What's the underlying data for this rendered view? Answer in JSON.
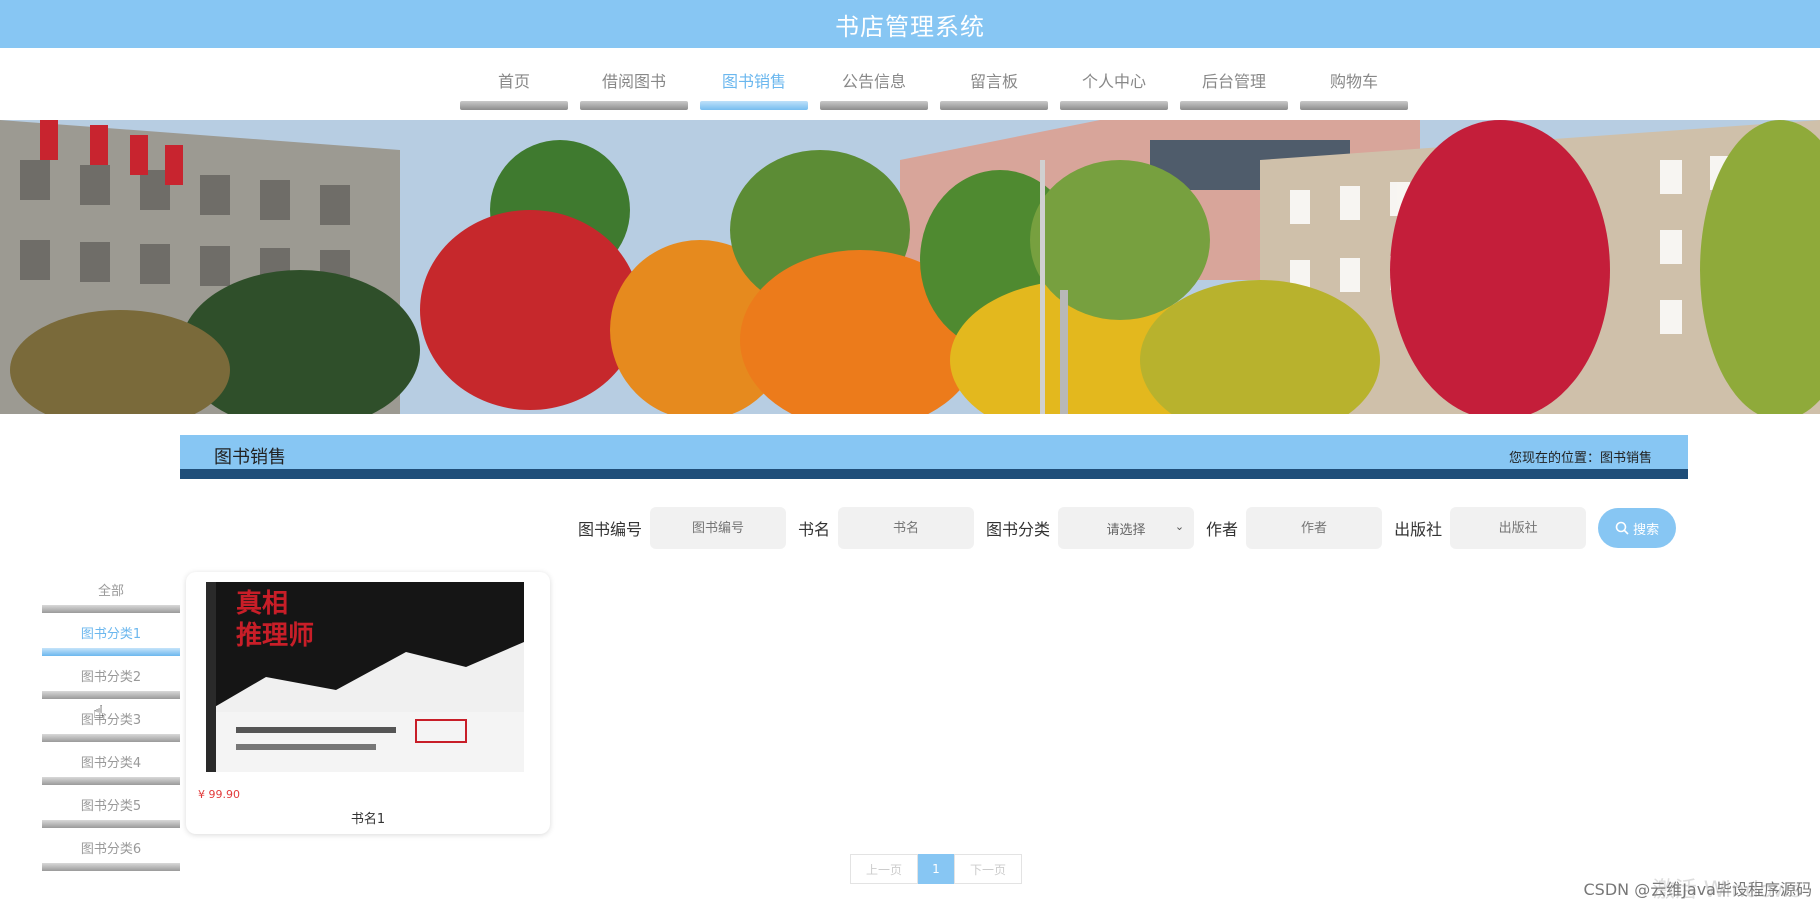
{
  "header": {
    "title": "书店管理系统"
  },
  "nav": {
    "items": [
      {
        "label": "首页"
      },
      {
        "label": "借阅图书"
      },
      {
        "label": "图书销售"
      },
      {
        "label": "公告信息"
      },
      {
        "label": "留言板"
      },
      {
        "label": "个人中心"
      },
      {
        "label": "后台管理"
      },
      {
        "label": "购物车"
      }
    ],
    "active": "图书销售"
  },
  "section": {
    "title": "图书销售",
    "location": "您现在的位置：图书销售"
  },
  "search": {
    "book_no_label": "图书编号",
    "book_no_placeholder": "图书编号",
    "name_label": "书名",
    "name_placeholder": "书名",
    "category_label": "图书分类",
    "category_selected": "请选择",
    "author_label": "作者",
    "author_placeholder": "作者",
    "publisher_label": "出版社",
    "publisher_placeholder": "出版社",
    "search_button": "搜索"
  },
  "categories": [
    {
      "label": "全部"
    },
    {
      "label": "图书分类1"
    },
    {
      "label": "图书分类2"
    },
    {
      "label": "图书分类3"
    },
    {
      "label": "图书分类4"
    },
    {
      "label": "图书分类5"
    },
    {
      "label": "图书分类6"
    }
  ],
  "products": [
    {
      "name": "书名1",
      "price": "¥ 99.90"
    }
  ],
  "pagination": {
    "prev": "上一页",
    "page": "1",
    "next": "下一页"
  },
  "watermark": "CSDN @云维Java毕设程序源码",
  "overlay": "激活 Windows",
  "colors": {
    "accent": "#87c6f3",
    "dark_bar": "#1f4e79",
    "price": "#e23b3b"
  }
}
